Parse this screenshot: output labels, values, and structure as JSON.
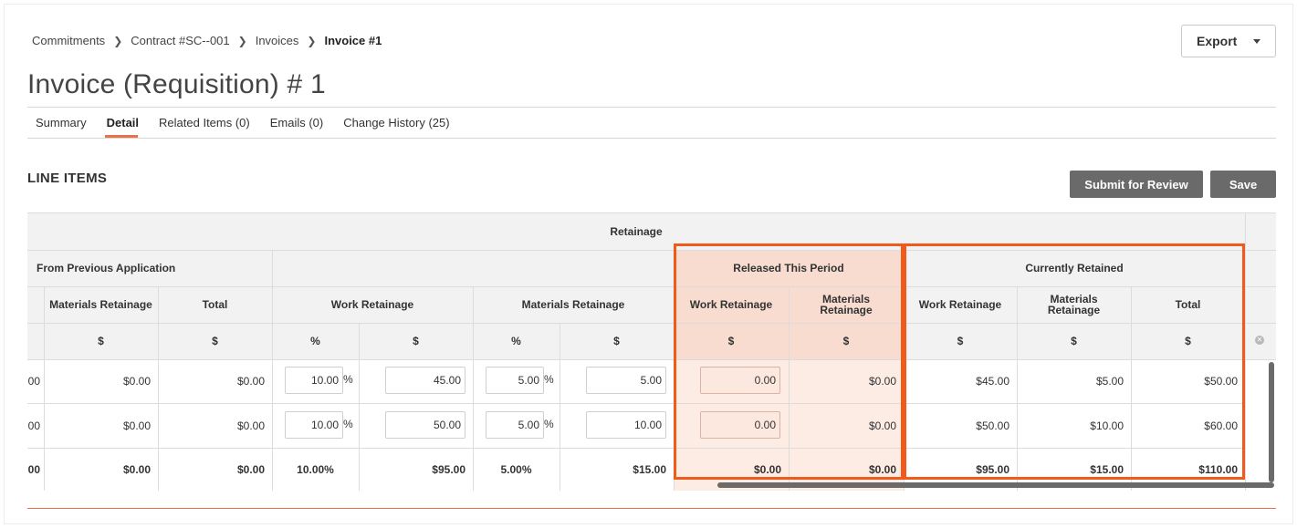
{
  "breadcrumb": {
    "items": [
      "Commitments",
      "Contract #SC--001",
      "Invoices"
    ],
    "current": "Invoice #1"
  },
  "export_label": "Export",
  "page_title": "Invoice (Requisition) # 1",
  "tabs": [
    {
      "label": "Summary",
      "active": false
    },
    {
      "label": "Detail",
      "active": true
    },
    {
      "label": "Related Items (0)",
      "active": false
    },
    {
      "label": "Emails (0)",
      "active": false
    },
    {
      "label": "Change History (25)",
      "active": false
    }
  ],
  "section_title": "LINE ITEMS",
  "buttons": {
    "submit": "Submit for Review",
    "save": "Save"
  },
  "colors": {
    "accent": "#e8734a",
    "highlight_border": "#f05a1a",
    "highlight_fill": "#fde8df",
    "button_dark": "#6a6a6a"
  },
  "table": {
    "group_header": "Retainage",
    "from_previous": "From Previous Application",
    "released": "Released This Period",
    "currently_retained": "Currently Retained",
    "col_headers": {
      "prev_materials": "Materials Retainage",
      "prev_total": "Total",
      "work": "Work Retainage",
      "materials": "Materials Retainage",
      "rel_work": "Work Retainage",
      "rel_materials": "Materials Retainage",
      "cur_work": "Work Retainage",
      "cur_materials": "Materials Retainage",
      "cur_total": "Total"
    },
    "units": {
      "dollar": "$",
      "percent": "%"
    },
    "rows": [
      {
        "cut": "00",
        "prev_materials": "$0.00",
        "prev_total": "$0.00",
        "work_pct": "10.00",
        "work_amt": "45.00",
        "mat_pct": "5.00",
        "mat_amt": "5.00",
        "rel_work": "0.00",
        "rel_materials": "$0.00",
        "cur_work": "$45.00",
        "cur_materials": "$5.00",
        "cur_total": "$50.00"
      },
      {
        "cut": "00",
        "prev_materials": "$0.00",
        "prev_total": "$0.00",
        "work_pct": "10.00",
        "work_amt": "50.00",
        "mat_pct": "5.00",
        "mat_amt": "10.00",
        "rel_work": "0.00",
        "rel_materials": "$0.00",
        "cur_work": "$50.00",
        "cur_materials": "$10.00",
        "cur_total": "$60.00"
      }
    ],
    "totals": {
      "cut": "00",
      "prev_materials": "$0.00",
      "prev_total": "$0.00",
      "work_pct": "10.00%",
      "work_amt": "$95.00",
      "mat_pct": "5.00%",
      "mat_amt": "$15.00",
      "rel_work": "$0.00",
      "rel_materials": "$0.00",
      "cur_work": "$95.00",
      "cur_materials": "$15.00",
      "cur_total": "$110.00"
    }
  }
}
